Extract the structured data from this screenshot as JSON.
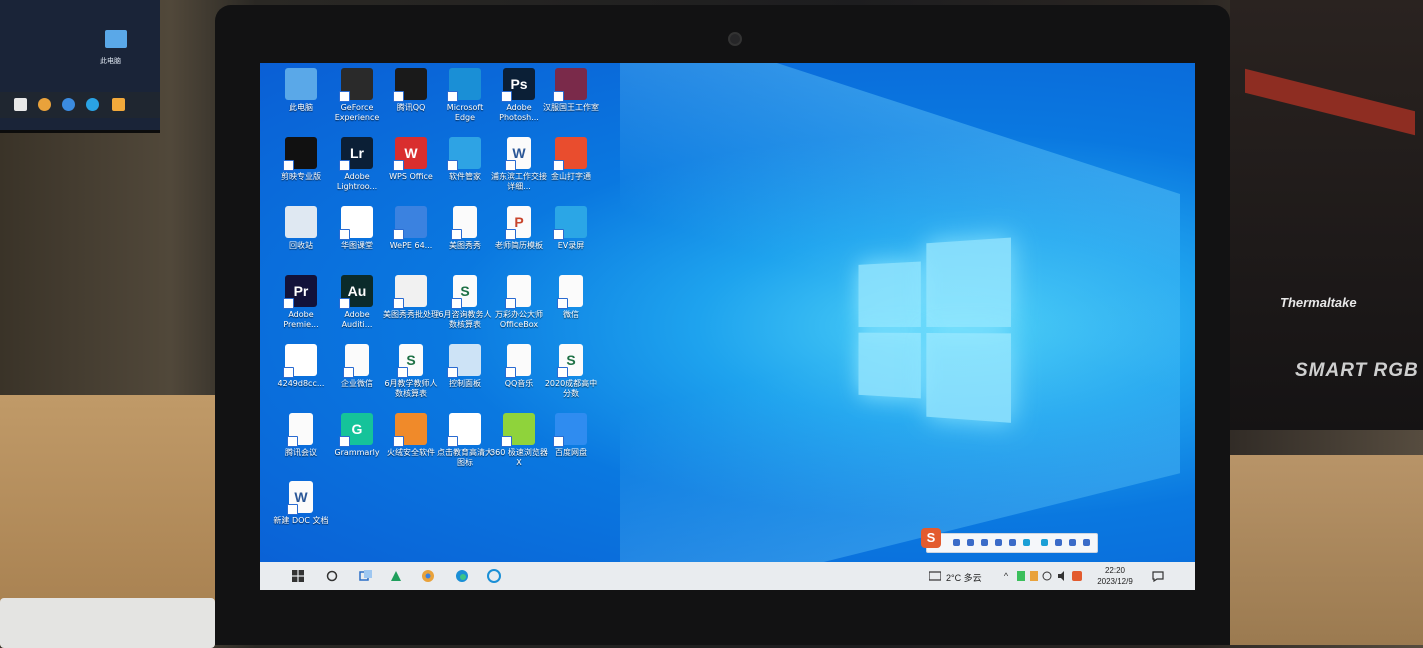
{
  "left_monitor": {
    "desktop_icon_label": "此电脑"
  },
  "background": {
    "case_brand": "Thermaltake",
    "ram_brand": "SMART RGB"
  },
  "desktop": {
    "icons": [
      {
        "label": "此电脑",
        "icon": "this-pc-icon"
      },
      {
        "label": "GeForce Experience",
        "icon": "geforce-icon"
      },
      {
        "label": "腾讯QQ",
        "icon": "qq-icon"
      },
      {
        "label": "Microsoft Edge",
        "icon": "edge-icon"
      },
      {
        "label": "Adobe Photosh...",
        "icon": "photoshop-icon"
      },
      {
        "label": "汉服国王工作室",
        "icon": "winrar-icon"
      },
      {
        "label": "剪映专业版",
        "icon": "capcut-icon"
      },
      {
        "label": "Adobe Lightroo...",
        "icon": "lightroom-icon"
      },
      {
        "label": "WPS Office",
        "icon": "wps-icon"
      },
      {
        "label": "软件管家",
        "icon": "software-manager-icon"
      },
      {
        "label": "浦东滨工作交接详细...",
        "icon": "word-doc-icon"
      },
      {
        "label": "金山打字通",
        "icon": "typing-icon"
      },
      {
        "label": "回收站",
        "icon": "recycle-bin-icon"
      },
      {
        "label": "华图课堂",
        "icon": "huatu-icon"
      },
      {
        "label": "WePE 64...",
        "icon": "wepe-icon"
      },
      {
        "label": "美图秀秀",
        "icon": "doc-icon"
      },
      {
        "label": "老师简历模板",
        "icon": "ppt-doc-icon"
      },
      {
        "label": "EV录屏",
        "icon": "ev-recorder-icon"
      },
      {
        "label": "Adobe Premie...",
        "icon": "premiere-icon"
      },
      {
        "label": "Adobe Auditi...",
        "icon": "audition-icon"
      },
      {
        "label": "美图秀秀批处理",
        "icon": "meitu-batch-icon"
      },
      {
        "label": "6月咨询教务人数核算表",
        "icon": "sheet-doc-icon"
      },
      {
        "label": "万彩办公大师OfficeBox",
        "icon": "doc-icon"
      },
      {
        "label": "微信",
        "icon": "doc-icon"
      },
      {
        "label": "4249d8cc...",
        "icon": "huatu-icon"
      },
      {
        "label": "企业微信",
        "icon": "doc-icon"
      },
      {
        "label": "6月教学教师人数核算表",
        "icon": "sheet-doc-icon"
      },
      {
        "label": "控制面板",
        "icon": "control-panel-icon"
      },
      {
        "label": "QQ音乐",
        "icon": "doc-icon"
      },
      {
        "label": "2020成都高中分数",
        "icon": "sheet-doc-icon"
      },
      {
        "label": "腾讯会议",
        "icon": "doc-icon"
      },
      {
        "label": "Grammarly",
        "icon": "grammarly-icon"
      },
      {
        "label": "火绒安全软件",
        "icon": "huorong-icon"
      },
      {
        "label": "点击教育高清大图标",
        "icon": "huatu-icon"
      },
      {
        "label": "360 极速浏览器X",
        "icon": "browser360-icon"
      },
      {
        "label": "百度网盘",
        "icon": "baidu-pan-icon"
      },
      {
        "label": "新建 DOC 文档",
        "icon": "word-doc-icon"
      }
    ]
  },
  "taskbar": {
    "pinned": [
      "start-icon",
      "search-icon",
      "task-view-icon",
      "app-icon",
      "chrome-icon",
      "edge-icon",
      "browser-icon"
    ],
    "weather": "2°C 多云",
    "time": "22:20",
    "date": "2023/12/9",
    "ime_logo": "S"
  },
  "colors": {
    "accent": "#0a78e0",
    "taskbar": "#e9ecef"
  }
}
